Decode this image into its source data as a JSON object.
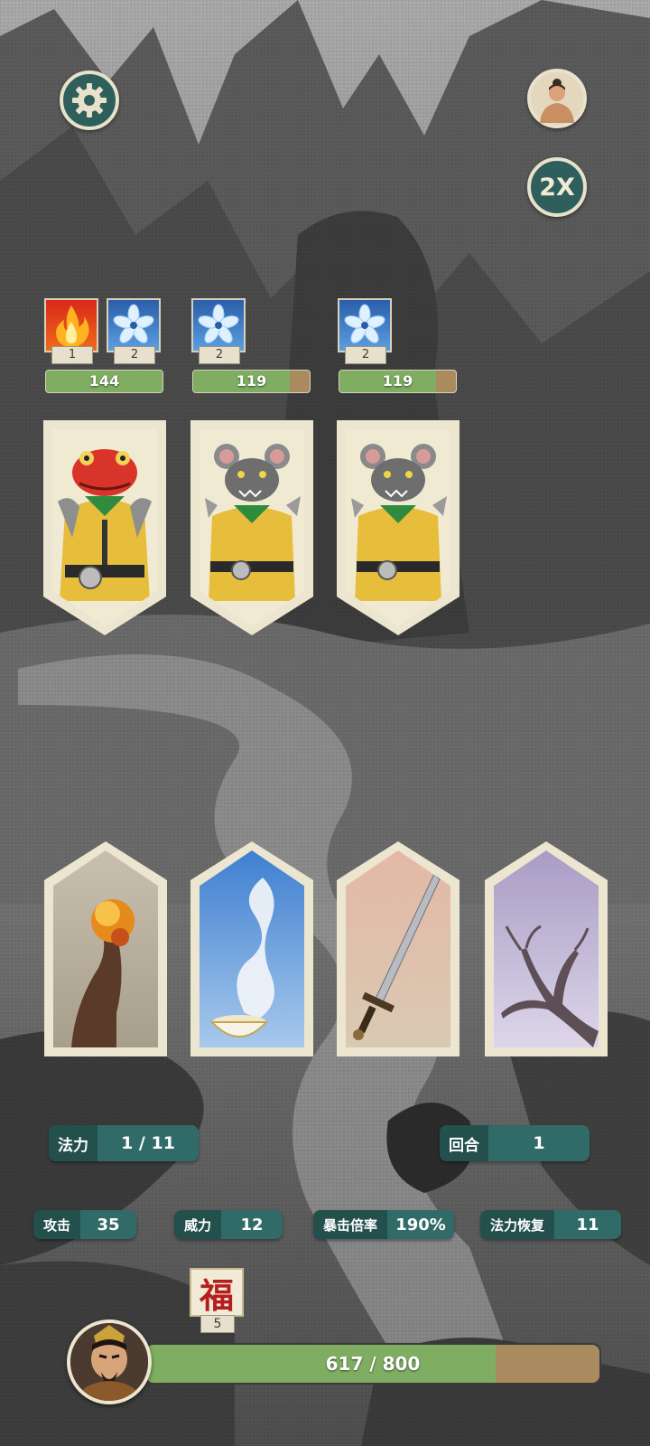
{
  "top_controls": {
    "settings_icon": "gear-icon",
    "profile_icon": "character-portrait-icon",
    "speed_label": "2X"
  },
  "enemies": [
    {
      "portrait": "toad-warrior",
      "statuses": [
        {
          "icon": "fire-icon",
          "stacks": "1"
        },
        {
          "icon": "ice-flower-icon",
          "stacks": "2"
        }
      ],
      "hp_text": "144",
      "hp_fraction": 1.0
    },
    {
      "portrait": "rat-warrior",
      "statuses": [
        {
          "icon": "ice-flower-icon",
          "stacks": "2"
        }
      ],
      "hp_text": "119",
      "hp_fraction": 0.83
    },
    {
      "portrait": "rat-warrior",
      "statuses": [
        {
          "icon": "ice-flower-icon",
          "stacks": "2"
        }
      ],
      "hp_text": "119",
      "hp_fraction": 0.83
    }
  ],
  "skill_cards": [
    {
      "art": "fire-burst"
    },
    {
      "art": "steaming-bowl"
    },
    {
      "art": "sword"
    },
    {
      "art": "snowy-tree"
    }
  ],
  "stats": {
    "mana": {
      "label": "法力",
      "value": "1 / 11"
    },
    "round": {
      "label": "回合",
      "value": "1"
    },
    "attack": {
      "label": "攻击",
      "value": "35"
    },
    "power": {
      "label": "威力",
      "value": "12"
    },
    "crit": {
      "label": "暴击倍率",
      "value": "190%"
    },
    "mana_regen": {
      "label": "法力恢复",
      "value": "11"
    }
  },
  "buff": {
    "glyph": "福",
    "count": "5"
  },
  "player": {
    "hp_text": "617 / 800",
    "hp_current": 617,
    "hp_max": 800,
    "colors": {
      "hp_fill": "#7fae62",
      "hp_empty": "#a98b5f",
      "panel": "#316b68"
    }
  }
}
